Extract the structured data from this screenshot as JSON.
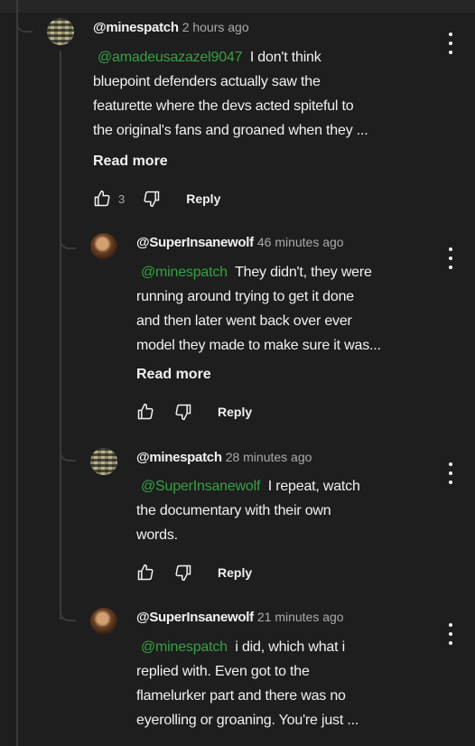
{
  "comments": [
    {
      "author": "@minespatch",
      "time": "2 hours ago",
      "mention": "@amadeusazazel9047",
      "text_lines": [
        "I don't think",
        "bluepoint defenders actually saw the",
        "featurette where the devs acted spiteful to",
        "the original's fans and groaned when they ..."
      ],
      "read_more": "Read more",
      "likes": "3",
      "reply": "Reply",
      "avatar_icon": "pixel-pattern-avatar"
    },
    {
      "author": "@SuperInsanewolf",
      "time": "46 minutes ago",
      "mention": "@minespatch",
      "text_lines": [
        "They didn't, they were",
        "running around trying to get it done",
        "and then later went back over ever",
        "model they made to make sure it was..."
      ],
      "read_more": "Read more",
      "reply": "Reply",
      "avatar_icon": "wolf-avatar"
    },
    {
      "author": "@minespatch",
      "time": "28 minutes ago",
      "mention": "@SuperInsanewolf",
      "text_lines": [
        "I repeat, watch",
        "the documentary with their own",
        "words."
      ],
      "reply": "Reply",
      "avatar_icon": "pixel-pattern-avatar"
    },
    {
      "author": "@SuperInsanewolf",
      "time": "21 minutes ago",
      "mention": "@minespatch",
      "text_lines": [
        "i did, which what i",
        "replied with. Even got to the",
        "flamelurker part and there was no",
        "eyerolling or groaning. You're just ..."
      ],
      "avatar_icon": "wolf-avatar"
    }
  ],
  "colors": {
    "mention": "#37a045",
    "background": "#1e1e1e",
    "meta": "#aaaaaa"
  }
}
